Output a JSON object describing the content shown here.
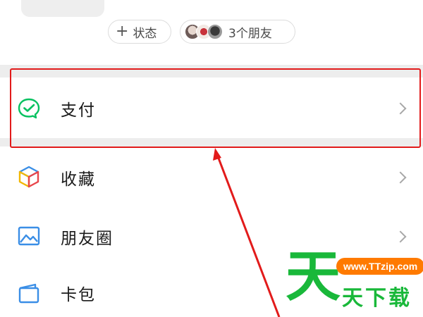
{
  "profile": {
    "status_label": "状态",
    "friends_label": "3个朋友"
  },
  "menu": [
    {
      "label": "支付",
      "icon": "wechat-pay-icon"
    },
    {
      "label": "收藏",
      "icon": "favorites-cube-icon"
    },
    {
      "label": "朋友圈",
      "icon": "moments-image-icon"
    },
    {
      "label": "卡包",
      "icon": "card-wallet-icon"
    }
  ],
  "watermark": {
    "big_char": "天",
    "url": "www.TTzip.com",
    "text": "天下载"
  },
  "colors": {
    "highlight": "#e21b1b",
    "pay_icon": "#07c160",
    "watermark_green": "#19b83a",
    "watermark_orange": "#ff7a00"
  }
}
